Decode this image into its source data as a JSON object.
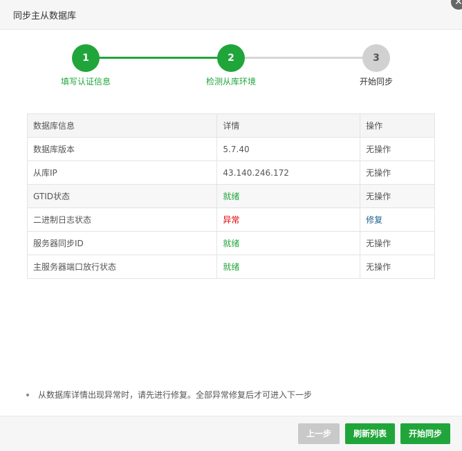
{
  "dialog": {
    "title": "同步主从数据库",
    "close_glyph": "✕"
  },
  "steps": [
    {
      "number": "1",
      "label": "填写认证信息",
      "status": "done"
    },
    {
      "number": "2",
      "label": "检测从库环境",
      "status": "done"
    },
    {
      "number": "3",
      "label": "开始同步",
      "status": "todo"
    }
  ],
  "table": {
    "headers": [
      "数据库信息",
      "详情",
      "操作"
    ],
    "rows": [
      {
        "name": "数据库版本",
        "detail": "5.7.40",
        "action": "无操作"
      },
      {
        "name": "从库IP",
        "detail": "43.140.246.172",
        "action": "无操作"
      },
      {
        "name": "GTID状态",
        "detail": "就绪",
        "action": "无操作"
      },
      {
        "name": "二进制日志状态",
        "detail": "异常",
        "action": "修复"
      },
      {
        "name": "服务器同步ID",
        "detail": "就绪",
        "action": "无操作"
      },
      {
        "name": "主服务器端口放行状态",
        "detail": "就绪",
        "action": "无操作"
      }
    ]
  },
  "note": "从数据库详情出现异常时，请先进行修复。全部异常修复后才可进入下一步",
  "footer": {
    "prev_label": "上一步",
    "refresh_label": "刷新列表",
    "start_label": "开始同步"
  },
  "colors": {
    "accent": "#20a53a",
    "error": "#e00000",
    "link": "#21648d",
    "disabled": "#c9c9c9"
  }
}
